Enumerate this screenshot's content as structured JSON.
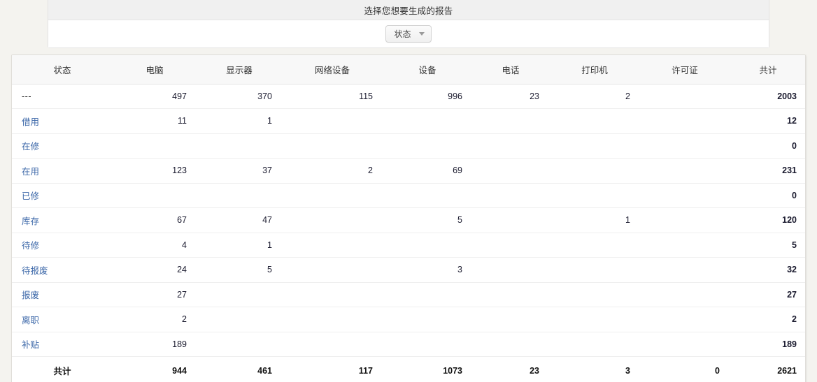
{
  "report_selector": {
    "title": "选择您想要生成的报告",
    "dropdown": {
      "label": "状态",
      "caret_icon": "chevron-down-icon"
    }
  },
  "table": {
    "headers": [
      "状态",
      "电脑",
      "显示器",
      "网络设备",
      "设备",
      "电话",
      "打印机",
      "许可证",
      "共计"
    ],
    "rows": [
      {
        "status": "---",
        "is_link": false,
        "values": [
          "497",
          "370",
          "115",
          "996",
          "23",
          "2",
          "",
          "2003"
        ]
      },
      {
        "status": "借用",
        "is_link": true,
        "values": [
          "11",
          "1",
          "",
          "",
          "",
          "",
          "",
          "12"
        ]
      },
      {
        "status": "在修",
        "is_link": true,
        "values": [
          "",
          "",
          "",
          "",
          "",
          "",
          "",
          "0"
        ]
      },
      {
        "status": "在用",
        "is_link": true,
        "values": [
          "123",
          "37",
          "2",
          "69",
          "",
          "",
          "",
          "231"
        ]
      },
      {
        "status": "已修",
        "is_link": true,
        "values": [
          "",
          "",
          "",
          "",
          "",
          "",
          "",
          "0"
        ]
      },
      {
        "status": "库存",
        "is_link": true,
        "values": [
          "67",
          "47",
          "",
          "5",
          "",
          "1",
          "",
          "120"
        ]
      },
      {
        "status": "待修",
        "is_link": true,
        "values": [
          "4",
          "1",
          "",
          "",
          "",
          "",
          "",
          "5"
        ]
      },
      {
        "status": "待报废",
        "is_link": true,
        "values": [
          "24",
          "5",
          "",
          "3",
          "",
          "",
          "",
          "32"
        ]
      },
      {
        "status": "报废",
        "is_link": true,
        "values": [
          "27",
          "",
          "",
          "",
          "",
          "",
          "",
          "27"
        ]
      },
      {
        "status": "离职",
        "is_link": true,
        "values": [
          "2",
          "",
          "",
          "",
          "",
          "",
          "",
          "2"
        ]
      },
      {
        "status": "补贴",
        "is_link": true,
        "values": [
          "189",
          "",
          "",
          "",
          "",
          "",
          "",
          "189"
        ]
      }
    ],
    "footer": {
      "label": "共计",
      "values": [
        "944",
        "461",
        "117",
        "1073",
        "23",
        "3",
        "0",
        "2621"
      ]
    }
  },
  "colors": {
    "page_background": "#f4f3ef",
    "panel_background": "#ffffff",
    "header_background": "#f8f8f8",
    "link": "#3b67a8",
    "text": "#1a1a2e"
  }
}
